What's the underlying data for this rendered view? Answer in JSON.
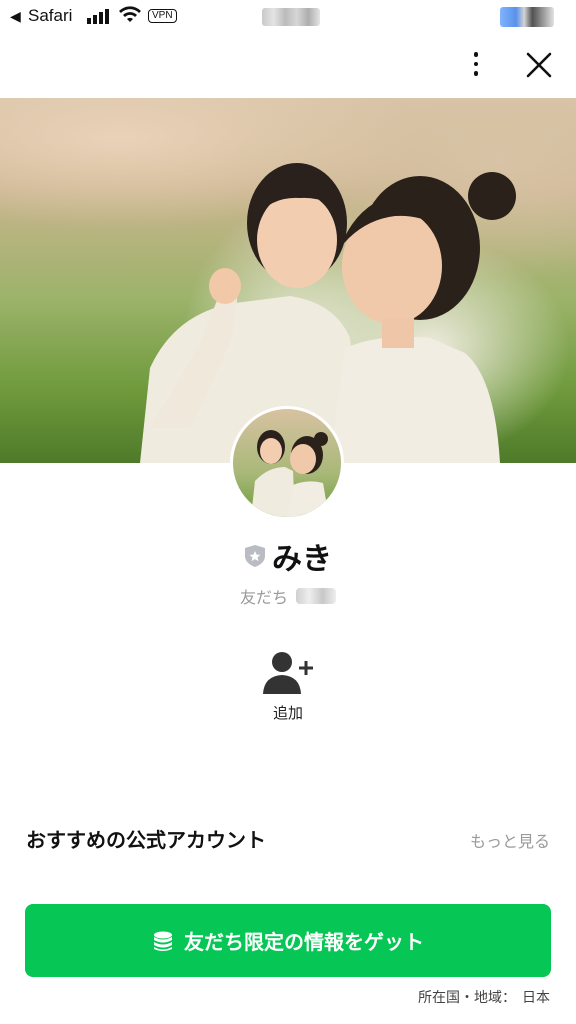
{
  "status_bar": {
    "back_glyph": "◀",
    "app": "Safari",
    "vpn": "VPN"
  },
  "profile": {
    "name": "みき",
    "sub_label": "友だち"
  },
  "actions": {
    "add_label": "追加"
  },
  "recommended": {
    "title": "おすすめの公式アカウント",
    "more": "もっと見る"
  },
  "cta": {
    "label": "友だち限定の情報をゲット"
  },
  "region": {
    "label": "所在国・地域：",
    "value": "日本"
  },
  "colors": {
    "accent_green": "#06c755"
  },
  "icons": [
    "more-vertical-icon",
    "close-icon",
    "verified-badge-icon",
    "add-friend-icon",
    "coin-stack-icon",
    "signal-icon",
    "wifi-icon"
  ]
}
